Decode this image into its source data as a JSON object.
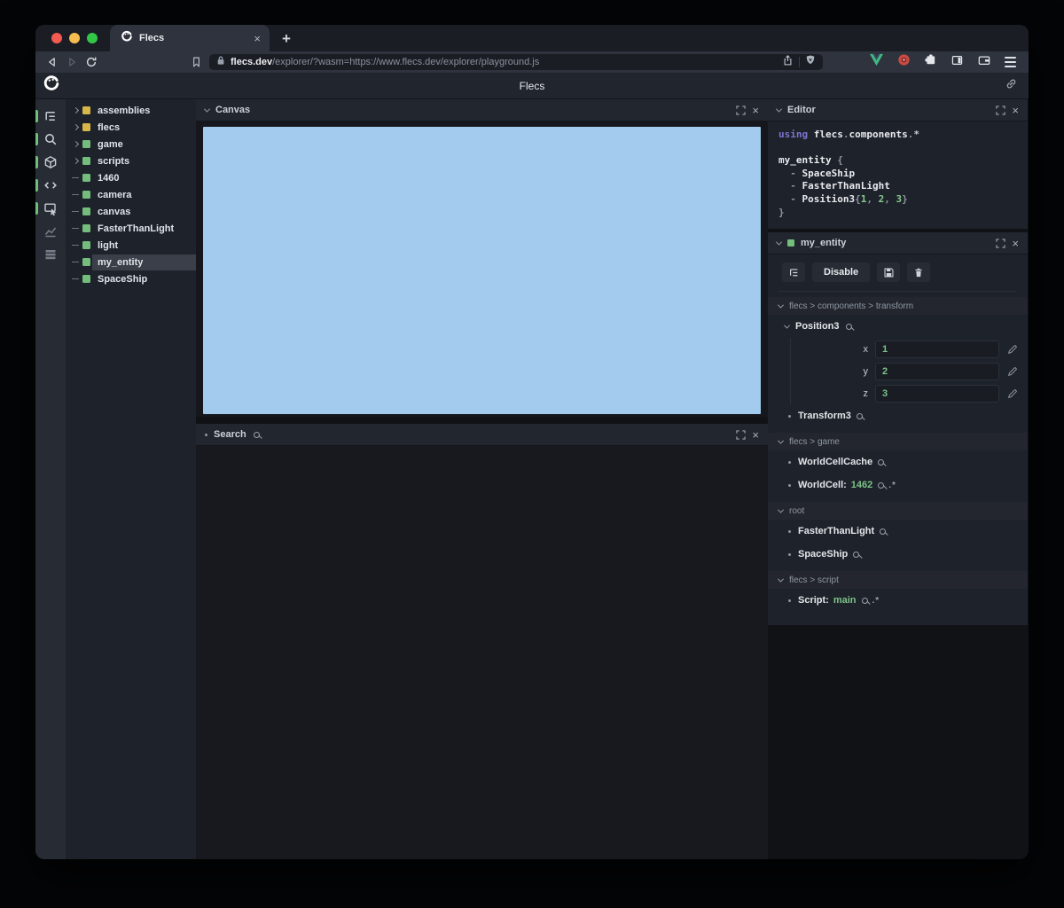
{
  "glyphs": {
    "plus": "+",
    "close": "×",
    "pair": ".*"
  },
  "browser": {
    "tab_title": "Flecs",
    "url": {
      "host": "flecs.dev",
      "path": "/explorer/?wasm=https://www.flecs.dev/explorer/playground.js"
    }
  },
  "header": {
    "title": "Flecs"
  },
  "sidebar": {
    "icons": [
      {
        "name": "outline-tree",
        "active": true
      },
      {
        "name": "search",
        "active": true
      },
      {
        "name": "cube",
        "active": true
      },
      {
        "name": "code",
        "active": true
      },
      {
        "name": "inspector",
        "active": true
      },
      {
        "name": "chart",
        "active": false
      },
      {
        "name": "rows",
        "active": false
      }
    ]
  },
  "tree": {
    "items": [
      {
        "label": "assemblies",
        "square": "#d8b74a",
        "expandable": true,
        "selected": false
      },
      {
        "label": "flecs",
        "square": "#d8b74a",
        "expandable": true,
        "selected": false
      },
      {
        "label": "game",
        "square": "#74bd7d",
        "expandable": true,
        "selected": false
      },
      {
        "label": "scripts",
        "square": "#74bd7d",
        "expandable": true,
        "selected": false
      },
      {
        "label": "1460",
        "square": "#74bd7d",
        "expandable": false,
        "selected": false
      },
      {
        "label": "camera",
        "square": "#74bd7d",
        "expandable": false,
        "selected": false
      },
      {
        "label": "canvas",
        "square": "#74bd7d",
        "expandable": false,
        "selected": false
      },
      {
        "label": "FasterThanLight",
        "square": "#74bd7d",
        "expandable": false,
        "selected": false
      },
      {
        "label": "light",
        "square": "#74bd7d",
        "expandable": false,
        "selected": false
      },
      {
        "label": "my_entity",
        "square": "#74bd7d",
        "expandable": false,
        "selected": true
      },
      {
        "label": "SpaceShip",
        "square": "#74bd7d",
        "expandable": false,
        "selected": false
      }
    ]
  },
  "panels": {
    "canvas": {
      "title": "Canvas",
      "viewport_color": "#a2cbee"
    },
    "search": {
      "title": "Search"
    },
    "editor": {
      "title": "Editor",
      "code": [
        [
          {
            "t": "using ",
            "c": "kw"
          },
          {
            "t": "flecs",
            "c": "id"
          },
          {
            "t": ".",
            "c": "op"
          },
          {
            "t": "components",
            "c": "id"
          },
          {
            "t": ".",
            "c": "op"
          },
          {
            "t": "*",
            "c": "st"
          }
        ],
        [],
        [
          {
            "t": "my_entity ",
            "c": "id"
          },
          {
            "t": "{",
            "c": "op"
          }
        ],
        [
          {
            "t": "  - ",
            "c": "op"
          },
          {
            "t": "SpaceShip",
            "c": "id"
          }
        ],
        [
          {
            "t": "  - ",
            "c": "op"
          },
          {
            "t": "FasterThanLight",
            "c": "id"
          }
        ],
        [
          {
            "t": "  - ",
            "c": "op"
          },
          {
            "t": "Position3",
            "c": "id"
          },
          {
            "t": "{",
            "c": "op"
          },
          {
            "t": "1",
            "c": "num"
          },
          {
            "t": ", ",
            "c": "op"
          },
          {
            "t": "2",
            "c": "num"
          },
          {
            "t": ", ",
            "c": "op"
          },
          {
            "t": "3",
            "c": "num"
          },
          {
            "t": "}",
            "c": "op"
          }
        ],
        [
          {
            "t": "}",
            "c": "op"
          }
        ]
      ]
    },
    "inspector": {
      "title": "my_entity",
      "buttons": {
        "disable_label": "Disable"
      },
      "sections": [
        {
          "path": "flecs > components > transform",
          "rows": [
            {
              "kind": "expanded",
              "name": "Position3",
              "fields": [
                [
                  "x",
                  "1"
                ],
                [
                  "y",
                  "2"
                ],
                [
                  "z",
                  "3"
                ]
              ]
            },
            {
              "kind": "component",
              "name": "Transform3"
            }
          ]
        },
        {
          "path": "flecs > game",
          "rows": [
            {
              "kind": "component",
              "name": "WorldCellCache"
            },
            {
              "kind": "component",
              "name": "WorldCell:",
              "value": "1462",
              "pair": true
            }
          ]
        },
        {
          "path": "root",
          "rows": [
            {
              "kind": "component",
              "name": "FasterThanLight"
            },
            {
              "kind": "component",
              "name": "SpaceShip"
            }
          ]
        },
        {
          "path": "flecs > script",
          "rows": [
            {
              "kind": "component",
              "name": "Script:",
              "value": "main",
              "pair": true
            }
          ]
        }
      ]
    }
  }
}
